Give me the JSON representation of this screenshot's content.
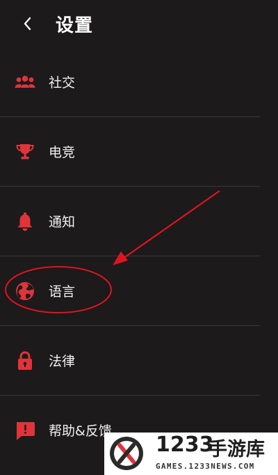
{
  "header": {
    "title": "设置",
    "back_icon": "chevron-left-icon"
  },
  "menu": {
    "items": [
      {
        "label": "社交",
        "icon": "group-icon"
      },
      {
        "label": "电竞",
        "icon": "trophy-icon"
      },
      {
        "label": "通知",
        "icon": "bell-icon"
      },
      {
        "label": "语言",
        "icon": "globe-icon"
      },
      {
        "label": "法律",
        "icon": "lock-icon"
      },
      {
        "label": "帮助&反馈",
        "icon": "feedback-icon"
      }
    ]
  },
  "watermark": {
    "number": "1233",
    "name": "手游库",
    "url": "GAMES.1233NEWS.COM"
  },
  "colors": {
    "background": "#1c1a1b",
    "accent": "#e0343a",
    "annotation": "#e0141e"
  }
}
